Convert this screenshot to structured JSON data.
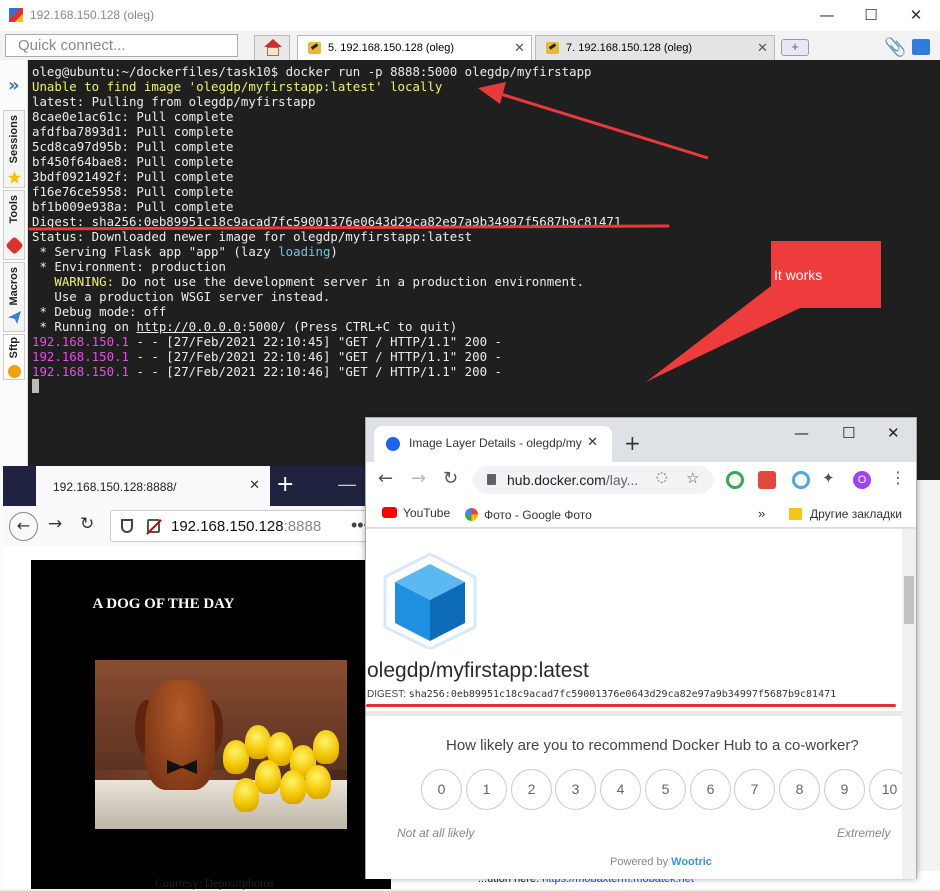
{
  "moba": {
    "title": "192.168.150.128 (oleg)",
    "quick_connect_placeholder": "Quick connect...",
    "tabs": [
      {
        "label": "5. 192.168.150.128 (oleg)"
      },
      {
        "label": "7. 192.168.150.128 (oleg)"
      }
    ],
    "sidebar": [
      "Sessions",
      "Tools",
      "Macros",
      "Sftp"
    ],
    "status": {
      "prefix": "...ution here:",
      "link": "https://mobaxterm.mobatek.net"
    }
  },
  "terminal": {
    "lines": [
      {
        "text": "oleg@ubuntu:~/dockerfiles/task10$ docker run -p 8888:5000 olegdp/myfirstapp"
      },
      {
        "text": "Unable to find image 'olegdp/myfirstapp:latest' locally"
      },
      {
        "text": "latest: Pulling from olegdp/myfirstapp"
      },
      {
        "text": "8cae0e1ac61c: Pull complete"
      },
      {
        "text": "afdfba7893d1: Pull complete"
      },
      {
        "text": "5cd8ca97d95b: Pull complete"
      },
      {
        "text": "bf450f64bae8: Pull complete"
      },
      {
        "text": "3bdf0921492f: Pull complete"
      },
      {
        "text": "f16e76ce5958: Pull complete"
      },
      {
        "text": "bf1b009e938a: Pull complete"
      },
      {
        "text": "Digest: sha256:0eb89951c18c9acad7fc59001376e0643d29ca82e97a9b34997f5687b9c81471"
      },
      {
        "text": "Status: Downloaded newer image for olegdp/myfirstapp:latest"
      },
      {
        "text": " * Serving Flask app \"app\" (lazy ",
        "extra": "loading",
        "suffix": ")"
      },
      {
        "text": " * Environment: production"
      },
      {
        "text": "   WARNING:",
        "rest": " Do not use the development server in a production environment."
      },
      {
        "text": "   Use a production WSGI server instead."
      },
      {
        "text": " * Debug mode: off"
      },
      {
        "text": " * Running on ",
        "link": "http://0.0.0.0",
        "rest": ":5000/ (Press CTRL+C to quit)"
      },
      {
        "ip": "192.168.150.1",
        "rest": " - - [27/Feb/2021 22:10:45] \"GET / HTTP/1.1\" 200 -"
      },
      {
        "ip": "192.168.150.1",
        "rest": " - - [27/Feb/2021 22:10:46] \"GET / HTTP/1.1\" 200 -"
      },
      {
        "ip": "192.168.150.1",
        "rest": " - - [27/Feb/2021 22:10:46] \"GET / HTTP/1.1\" 200 -"
      }
    ]
  },
  "annotation": {
    "callout_text": "It works",
    "color": "#e83a3a"
  },
  "firefox": {
    "tab_title": "192.168.150.128:8888/",
    "url_host": "192.168.150.128",
    "url_port": ":8888",
    "page_title": "A DOG OF THE DAY",
    "footer_text": "Courtesy: Depositphotos"
  },
  "chrome": {
    "tab_title": "Image Layer Details - olegdp/my",
    "url_host": "hub.docker.com",
    "url_path": "/lay...",
    "bookmarks": [
      "YouTube",
      "Фото - Google Фото",
      "Другие закладки"
    ],
    "profile_initial": "O",
    "repo": "olegdp/myfirstapp:latest",
    "digest_label": "DIGEST:",
    "digest_hash": "sha256:0eb89951c18c9acad7fc59001376e0643d29ca82e97a9b34997f5687b9c81471",
    "survey_question": "How likely are you to recommend Docker Hub to a co-worker?",
    "scale": [
      "0",
      "1",
      "2",
      "3",
      "4",
      "5",
      "6",
      "7",
      "8",
      "9",
      "10"
    ],
    "low_label": "Not at all likely",
    "high_label": "Extremely",
    "powered_prefix": "Powered by",
    "powered_brand": "Wootric"
  }
}
